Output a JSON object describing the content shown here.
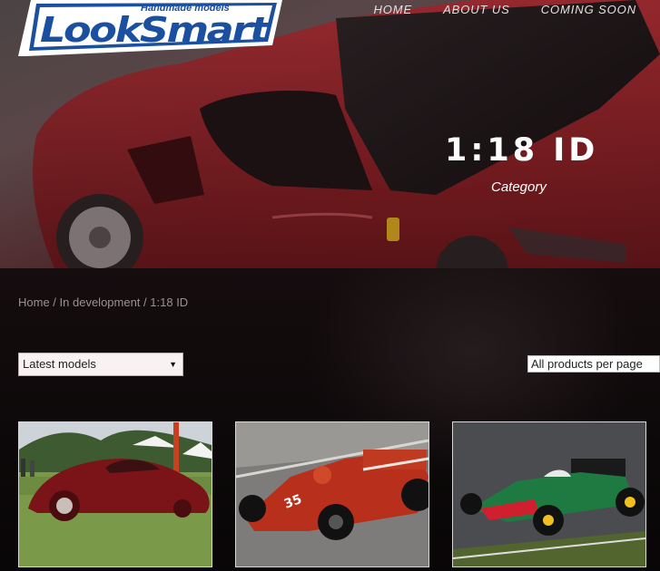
{
  "brand": {
    "logo_text": "LookSmart",
    "tagline": "Handmade models"
  },
  "nav": {
    "items": [
      "HOME",
      "ABOUT US",
      "COMING SOON"
    ]
  },
  "hero": {
    "title": "1:18 ID",
    "subtitle": "Category"
  },
  "breadcrumb": {
    "home": "Home",
    "parent": "In development",
    "current": "1:18 ID",
    "separator": " / "
  },
  "filters": {
    "sort_value": "Latest models",
    "per_page_value": "All products per page"
  },
  "products": [
    {
      "image": "red-vintage-streamliner-car"
    },
    {
      "image": "red-alfa-romeo-f1-car-35"
    },
    {
      "image": "green-benetton-f1-car"
    }
  ],
  "colors": {
    "accent_red": "#b01f25",
    "logo_blue": "#1b4fa0"
  }
}
